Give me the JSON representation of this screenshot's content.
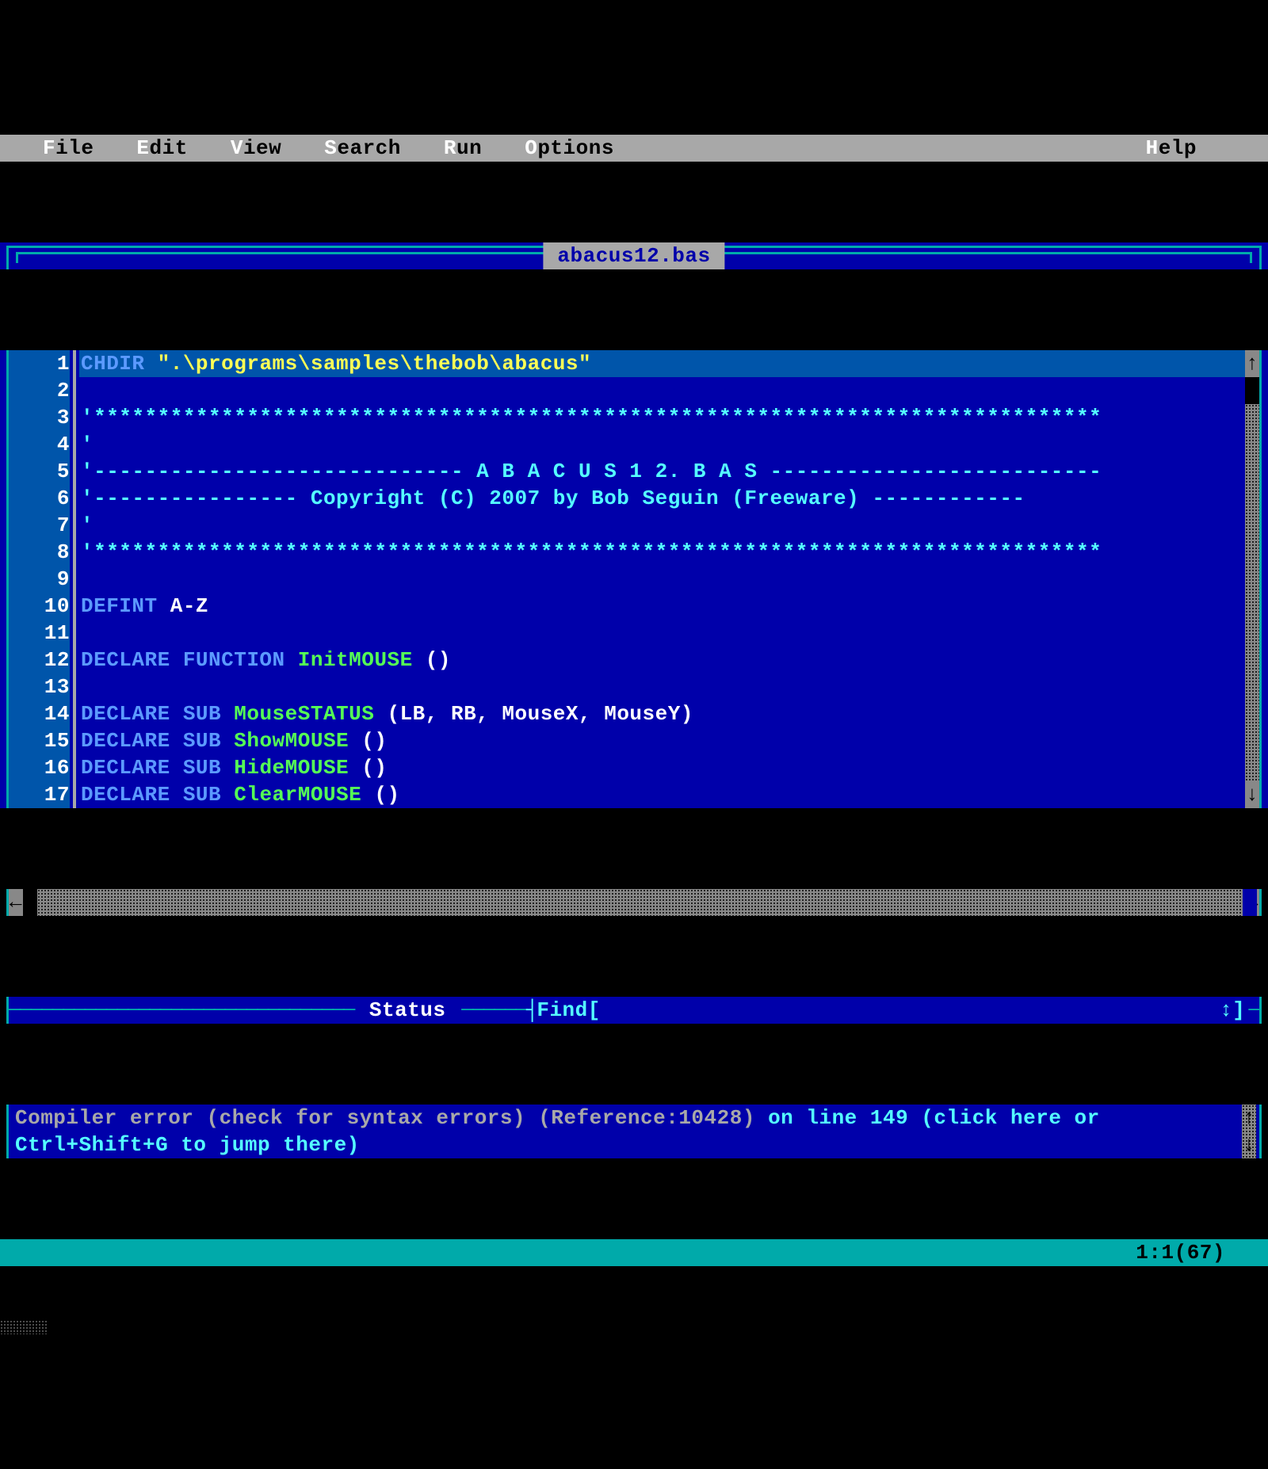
{
  "menubar": {
    "items": [
      {
        "hot": "F",
        "rest": "ile"
      },
      {
        "hot": "E",
        "rest": "dit"
      },
      {
        "hot": "V",
        "rest": "iew"
      },
      {
        "hot": "S",
        "rest": "earch"
      },
      {
        "hot": "R",
        "rest": "un"
      },
      {
        "hot": "O",
        "rest": "ptions"
      }
    ],
    "help": {
      "hot": "H",
      "rest": "elp"
    }
  },
  "title": "abacus12.bas",
  "code": {
    "current_line": 1,
    "lines": [
      {
        "n": 1,
        "tokens": [
          {
            "c": "kw",
            "t": "CHDIR "
          },
          {
            "c": "str",
            "t": "\".\\programs\\samples\\thebob\\abacus\""
          }
        ]
      },
      {
        "n": 2,
        "tokens": []
      },
      {
        "n": 3,
        "tokens": [
          {
            "c": "cmt",
            "t": "'*******************************************************************************"
          }
        ]
      },
      {
        "n": 4,
        "tokens": [
          {
            "c": "cmt",
            "t": "'"
          }
        ]
      },
      {
        "n": 5,
        "tokens": [
          {
            "c": "cmt",
            "t": "'----------------------------- A B A C U S 1 2. B A S --------------------------"
          }
        ]
      },
      {
        "n": 6,
        "tokens": [
          {
            "c": "cmt",
            "t": "'---------------- Copyright (C) 2007 by Bob Seguin (Freeware) ------------"
          }
        ]
      },
      {
        "n": 7,
        "tokens": [
          {
            "c": "cmt",
            "t": "'"
          }
        ]
      },
      {
        "n": 8,
        "tokens": [
          {
            "c": "cmt",
            "t": "'*******************************************************************************"
          }
        ]
      },
      {
        "n": 9,
        "tokens": []
      },
      {
        "n": 10,
        "tokens": [
          {
            "c": "kw",
            "t": "DEFINT "
          },
          {
            "c": "txt",
            "t": "A-Z"
          }
        ]
      },
      {
        "n": 11,
        "tokens": []
      },
      {
        "n": 12,
        "tokens": [
          {
            "c": "kw",
            "t": "DECLARE FUNCTION "
          },
          {
            "c": "fn",
            "t": "InitMOUSE "
          },
          {
            "c": "txt",
            "t": "()"
          }
        ]
      },
      {
        "n": 13,
        "tokens": []
      },
      {
        "n": 14,
        "tokens": [
          {
            "c": "kw",
            "t": "DECLARE SUB "
          },
          {
            "c": "fn",
            "t": "MouseSTATUS "
          },
          {
            "c": "txt",
            "t": "(LB, RB, MouseX, MouseY)"
          }
        ]
      },
      {
        "n": 15,
        "tokens": [
          {
            "c": "kw",
            "t": "DECLARE SUB "
          },
          {
            "c": "fn",
            "t": "ShowMOUSE "
          },
          {
            "c": "txt",
            "t": "()"
          }
        ]
      },
      {
        "n": 16,
        "tokens": [
          {
            "c": "kw",
            "t": "DECLARE SUB "
          },
          {
            "c": "fn",
            "t": "HideMOUSE "
          },
          {
            "c": "txt",
            "t": "()"
          }
        ]
      },
      {
        "n": 17,
        "tokens": [
          {
            "c": "kw",
            "t": "DECLARE SUB "
          },
          {
            "c": "fn",
            "t": "ClearMOUSE "
          },
          {
            "c": "txt",
            "t": "()"
          }
        ]
      }
    ]
  },
  "divider": {
    "status_label": "Status",
    "find_label": "Find[",
    "tail": "↕]"
  },
  "error": {
    "plain": "Compiler error (check for syntax errors) (Reference:10428) ",
    "link": "on line 149 (click here or Ctrl+Shift+G to jump there)"
  },
  "status": {
    "pos": "1:1(67)"
  }
}
